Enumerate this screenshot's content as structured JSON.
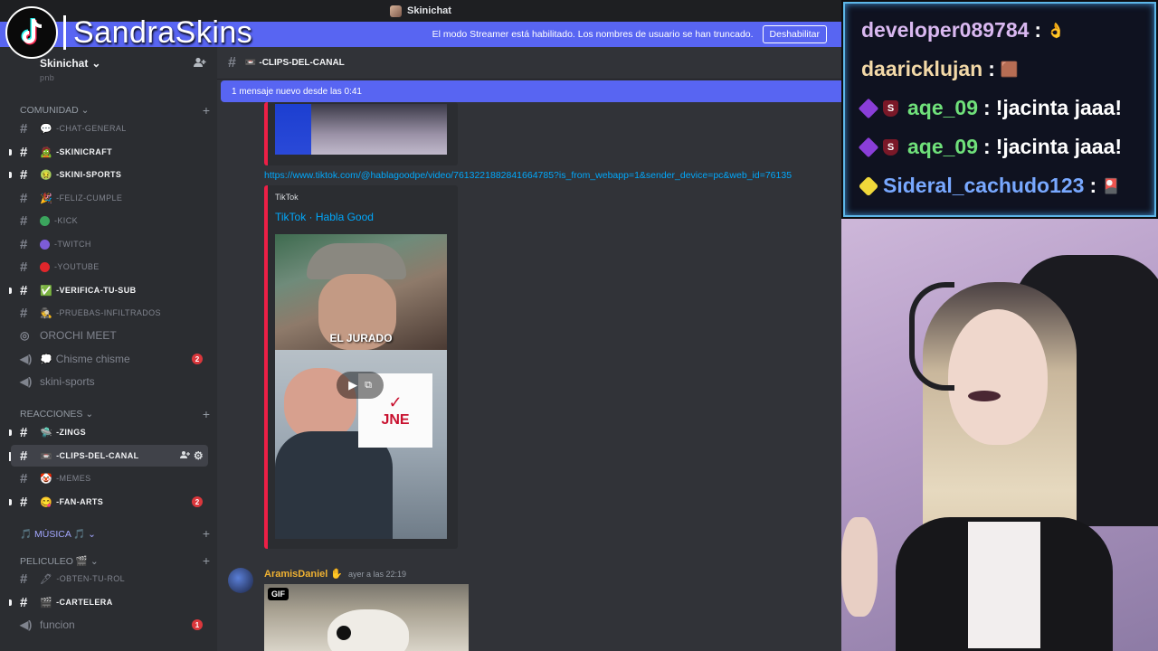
{
  "overlay": {
    "streamer_name": "SandraSkins"
  },
  "window": {
    "title": "Skinichat"
  },
  "streamer_banner": {
    "text": "El modo Streamer está habilitado. Los nombres de usuario se han truncado.",
    "button": "Deshabilitar"
  },
  "server": {
    "name": "Skinichat",
    "chevron": "⌄"
  },
  "sidebar": {
    "truncated_top": "pnb",
    "cat_comunidad": "COMUNIDAD ⌄",
    "cat_reacciones": "REACCIONES ⌄",
    "cat_musica": "🎵 MÚSICA 🎵 ⌄",
    "cat_peliculeo": "PELICULEO 🎬 ⌄",
    "channels": [
      {
        "label": "-CHAT-GENERAL",
        "emoji": "💬"
      },
      {
        "label": "-SKINICRAFT",
        "emoji": "🧟"
      },
      {
        "label": "-SKINI-SPORTS",
        "emoji": "🤢"
      },
      {
        "label": "-FELIZ-CUMPLE",
        "emoji": "🎉"
      },
      {
        "label": "-KICK",
        "color": "#3ba55d"
      },
      {
        "label": "-TWITCH",
        "color": "#7c5cd8"
      },
      {
        "label": "-YOUTUBE",
        "color": "#e0262b"
      },
      {
        "label": "-VERIFICA-TU-SUB",
        "emoji": "✅"
      },
      {
        "label": "-PRUEBAS-INFILTRADOS",
        "emoji": "🕵"
      },
      {
        "label": "OROCHI MEET"
      },
      {
        "label": "Chisme chisme",
        "emoji": "💭",
        "badge": "2"
      },
      {
        "label": "skini-sports"
      },
      {
        "label": "-ZINGS",
        "emoji": "🛸"
      },
      {
        "label": "-CLIPS-DEL-CANAL",
        "emoji": "📼"
      },
      {
        "label": "-MEMES",
        "emoji": "🤡"
      },
      {
        "label": "-FAN-ARTS",
        "emoji": "😋",
        "badge": "2"
      },
      {
        "label": "-OBTEN-TU-ROL",
        "emoji": "🖋"
      },
      {
        "label": "-CARTELERA",
        "emoji": "🎬"
      },
      {
        "label": "funcion",
        "badge": "1"
      }
    ]
  },
  "channel_header": {
    "name": "-CLIPS-DEL-CANAL",
    "emoji": "📼"
  },
  "new_messages_bar": "1 mensaje nuevo desde las 0:41",
  "messages": {
    "link": "https://www.tiktok.com/@hablagoodpe/video/7613221882841664785?is_from_webapp=1&sender_device=pc&web_id=76135",
    "embed_provider": "TikTok",
    "embed_title": "TikTok · Habla Good",
    "thumbnail_caption": "EL JURADO",
    "thumbnail_logo": "JNE",
    "author": "AramisDaniel",
    "timestamp": "ayer a las 22:19",
    "gif_label": "GIF"
  },
  "stream_chat": [
    {
      "user": "developer089784",
      "message": "👌",
      "user_color": "#d9b8f0"
    },
    {
      "user": "daaricklujan",
      "message": "🟫",
      "user_color": "#f3d9a8"
    },
    {
      "user": "aqe_09",
      "message": "!jacinta jaaa!",
      "user_color": "#6fe07a",
      "badges": [
        "S"
      ]
    },
    {
      "user": "aqe_09",
      "message": "!jacinta jaaa!",
      "user_color": "#6fe07a",
      "badges": [
        "S"
      ]
    },
    {
      "user": "Sideral_cachudo123",
      "message": "🎴",
      "user_color": "#78a8ff"
    }
  ],
  "colors": {
    "blurple": "#5865f2",
    "tiktok_red": "#ed1f46",
    "link": "#00a8fc",
    "mention_badge": "#da373c"
  }
}
